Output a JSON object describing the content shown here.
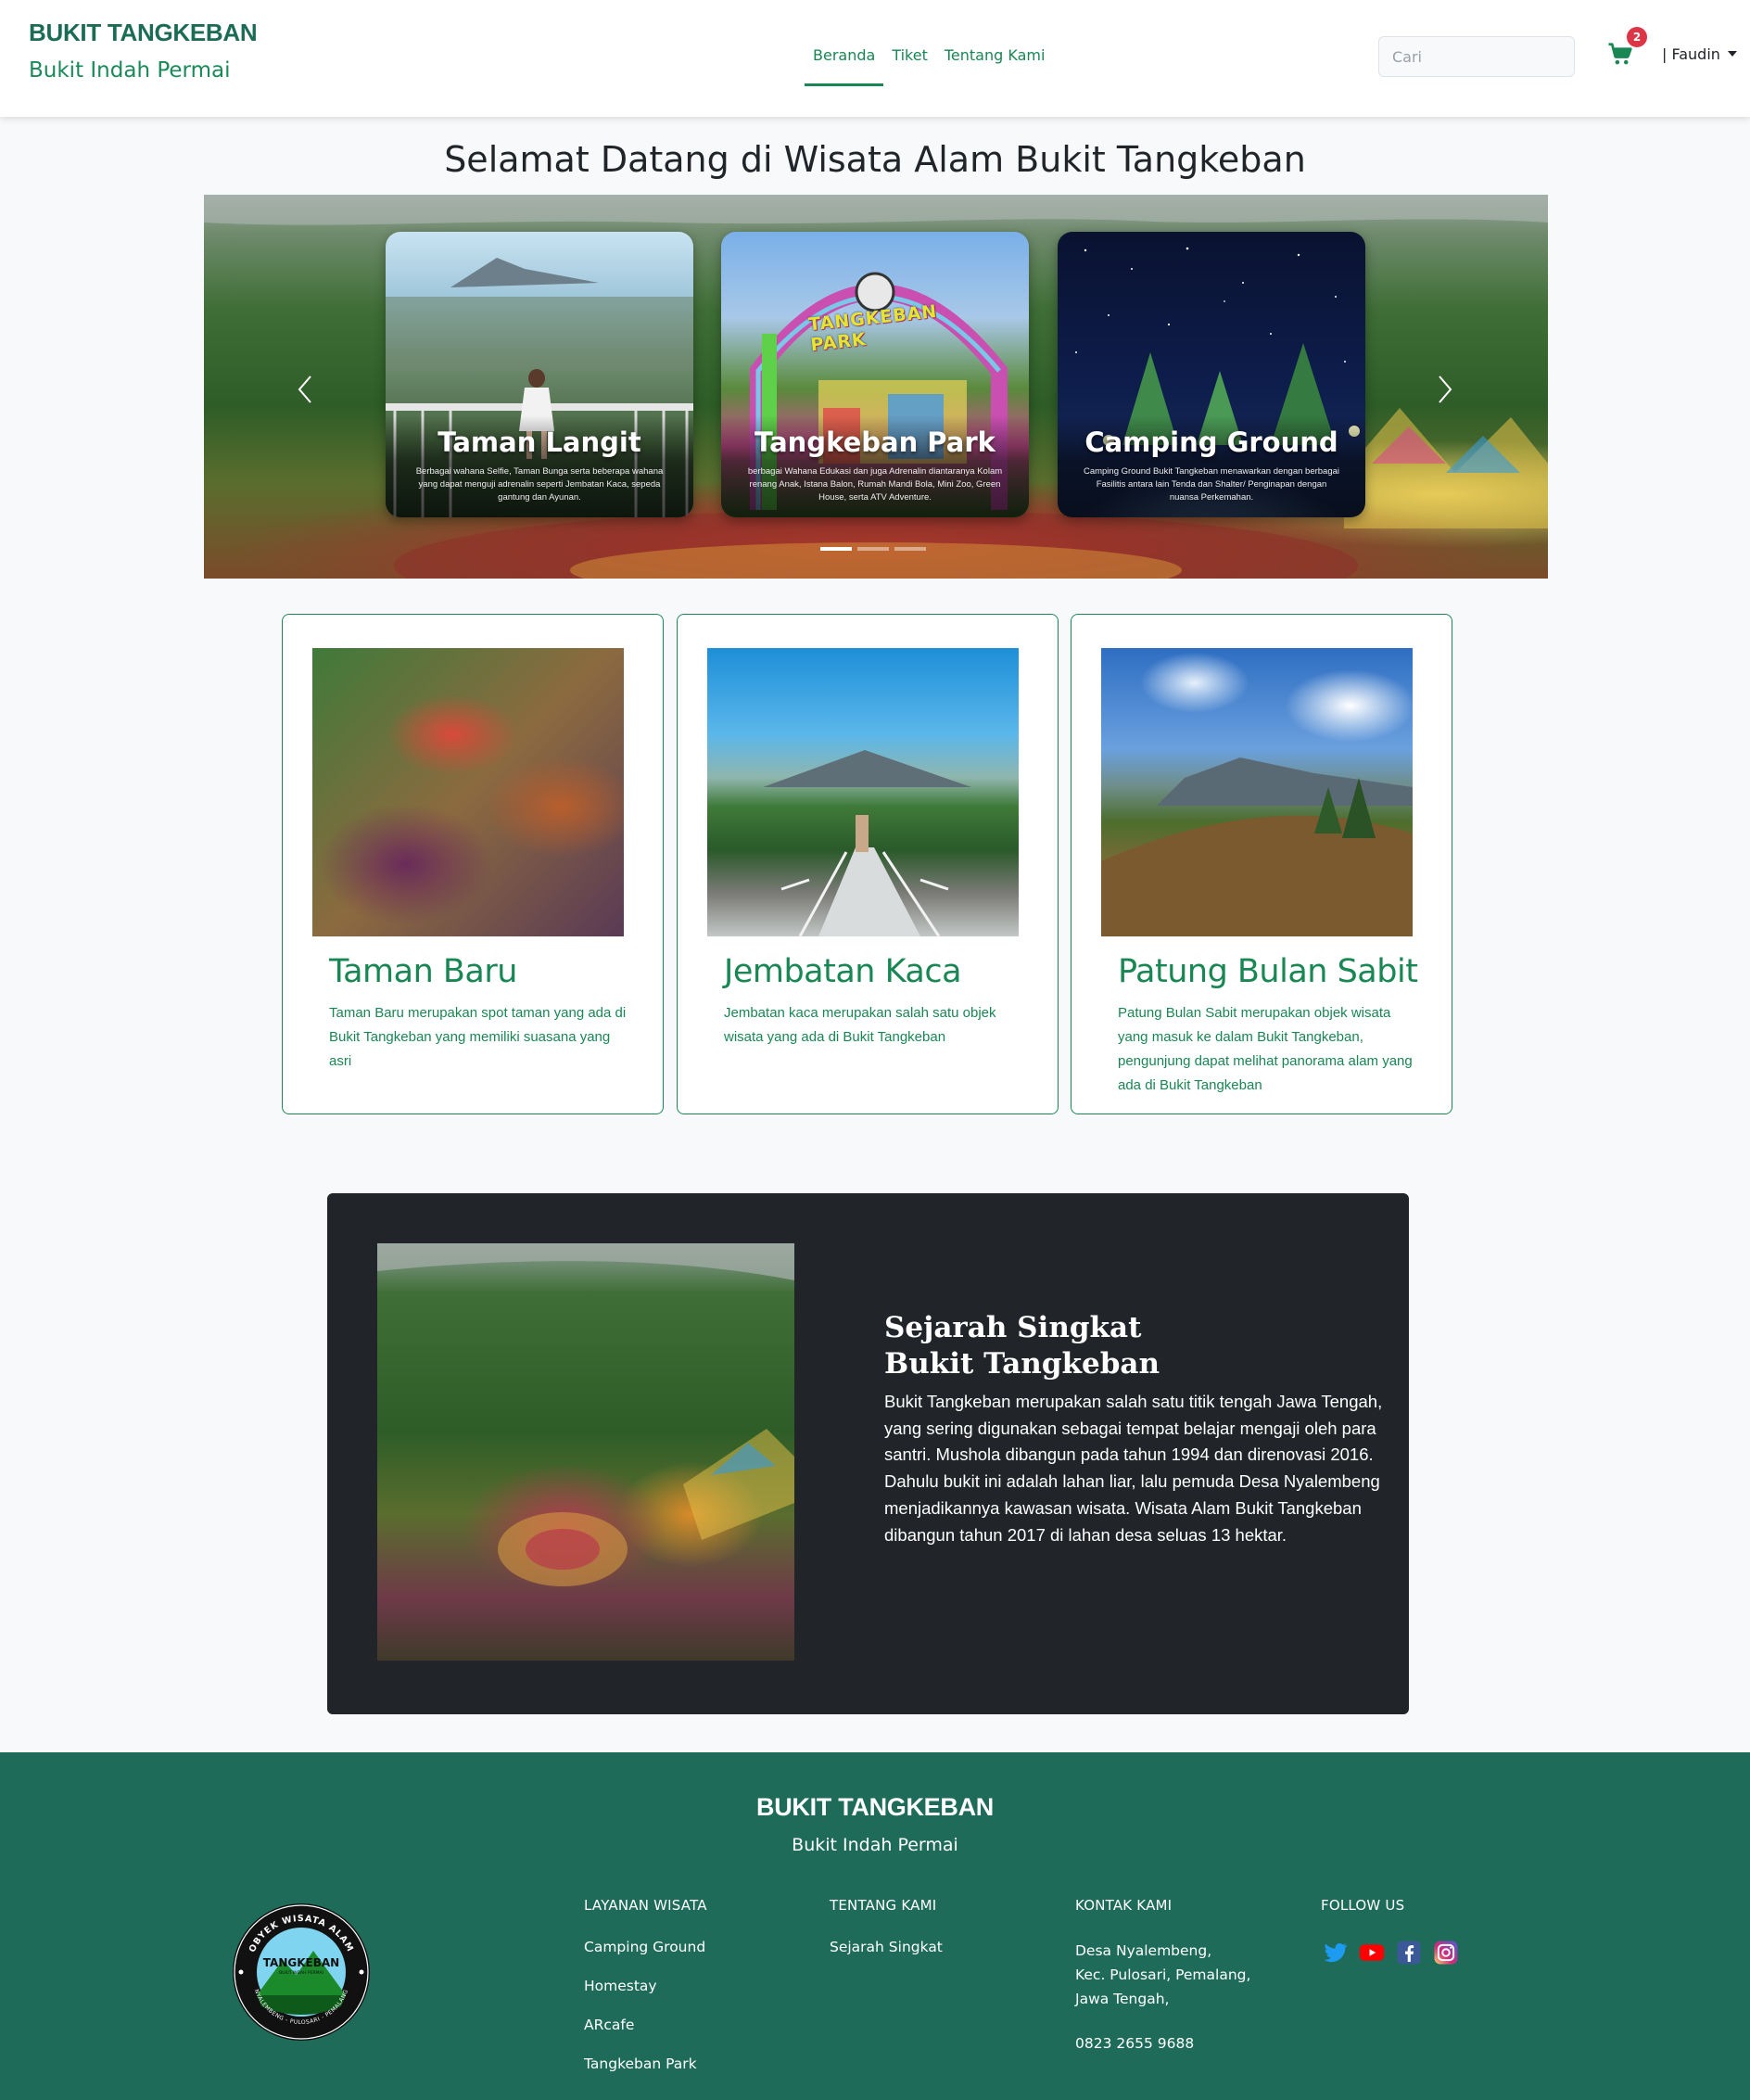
{
  "navbar": {
    "brand_title": "BUKIT TANGKEBAN",
    "brand_subtitle": "Bukit Indah Permai",
    "links": [
      {
        "label": "Beranda",
        "active": true
      },
      {
        "label": "Tiket",
        "active": false
      },
      {
        "label": "Tentang Kami",
        "active": false
      }
    ],
    "search_placeholder": "Cari",
    "cart_icon": "cart-icon",
    "cart_count": "2",
    "user_label": "| Faudin"
  },
  "hero": {
    "welcome": "Selamat Datang di Wisata Alam Bukit Tangkeban",
    "slides": [
      {
        "title": "Taman Langit",
        "desc": "Berbagai wahana Selfie, Taman Bunga serta beberapa wahana yang dapat menguji adrenalin seperti Jembatan Kaca, sepeda gantung dan Ayunan."
      },
      {
        "title": "Tangkeban Park",
        "desc": "berbagai Wahana Edukasi dan juga Adrenalin diantaranya Kolam renang Anak, Istana Balon, Rumah Mandi Bola, Mini Zoo, Green House, serta ATV Adventure."
      },
      {
        "title": "Camping Ground",
        "desc": "Camping Ground Bukit Tangkeban menawarkan dengan berbagai Fasilitis antara lain Tenda dan Shalter/ Penginapan dengan nuansa Perkemahan."
      }
    ],
    "park_sign": "TANGKEBAN PARK",
    "indicator_count": 3,
    "active_indicator": 0
  },
  "cards": [
    {
      "title": "Taman Baru",
      "text": "Taman Baru merupakan spot taman yang ada di Bukit Tangkeban yang memiliki suasana yang asri"
    },
    {
      "title": "Jembatan Kaca",
      "text": "Jembatan kaca merupakan salah satu objek wisata yang ada di Bukit Tangkeban"
    },
    {
      "title": "Patung Bulan Sabit",
      "text": "Patung Bulan Sabit merupakan objek wisata yang masuk ke dalam Bukit Tangkeban, pengunjung dapat melihat panorama alam yang ada di Bukit Tangkeban"
    }
  ],
  "history": {
    "title_line1": "Sejarah Singkat",
    "title_line2": "Bukit Tangkeban",
    "text": "Bukit Tangkeban merupakan salah satu titik tengah Jawa Tengah, yang sering digunakan sebagai tempat belajar mengaji oleh para santri. Mushola dibangun pada tahun 1994 dan direnovasi 2016. Dahulu bukit ini adalah lahan liar, lalu pemuda Desa Nyalembeng menjadikannya kawasan wisata. Wisata Alam Bukit Tangkeban dibangun tahun 2017 di lahan desa seluas 13 hektar."
  },
  "footer": {
    "title": "BUKIT TANGKEBAN",
    "subtitle": "Bukit Indah Permai",
    "logo_text_top": "OBYEK WISATA ALAM",
    "logo_text_center": "TANGKEBAN",
    "logo_text_small": "BUKIT INDAH PERMAI",
    "logo_text_bottom": "NYALEMBENG - PULOSARI - PEMALANG",
    "col_layanan": {
      "heading": "LAYANAN WISATA",
      "links": [
        "Camping Ground",
        "Homestay",
        "ARcafe",
        "Tangkeban Park"
      ]
    },
    "col_tentang": {
      "heading": "TENTANG KAMI",
      "links": [
        "Sejarah Singkat"
      ]
    },
    "col_kontak": {
      "heading": "KONTAK KAMI",
      "address_line1": "Desa Nyalembeng,",
      "address_line2": "Kec. Pulosari, Pemalang,",
      "address_line3": "Jawa Tengah,",
      "phone": "0823 2655 9688"
    },
    "col_follow": {
      "heading": "FOLLOW US",
      "icons": [
        "twitter-icon",
        "youtube-icon",
        "facebook-icon",
        "instagram-icon"
      ]
    }
  },
  "colors": {
    "brand_green": "#198754",
    "brand_dark_green": "#1b6b55",
    "footer_bg": "#1e6b5a",
    "history_bg": "#212529",
    "badge_red": "#dc3545"
  }
}
